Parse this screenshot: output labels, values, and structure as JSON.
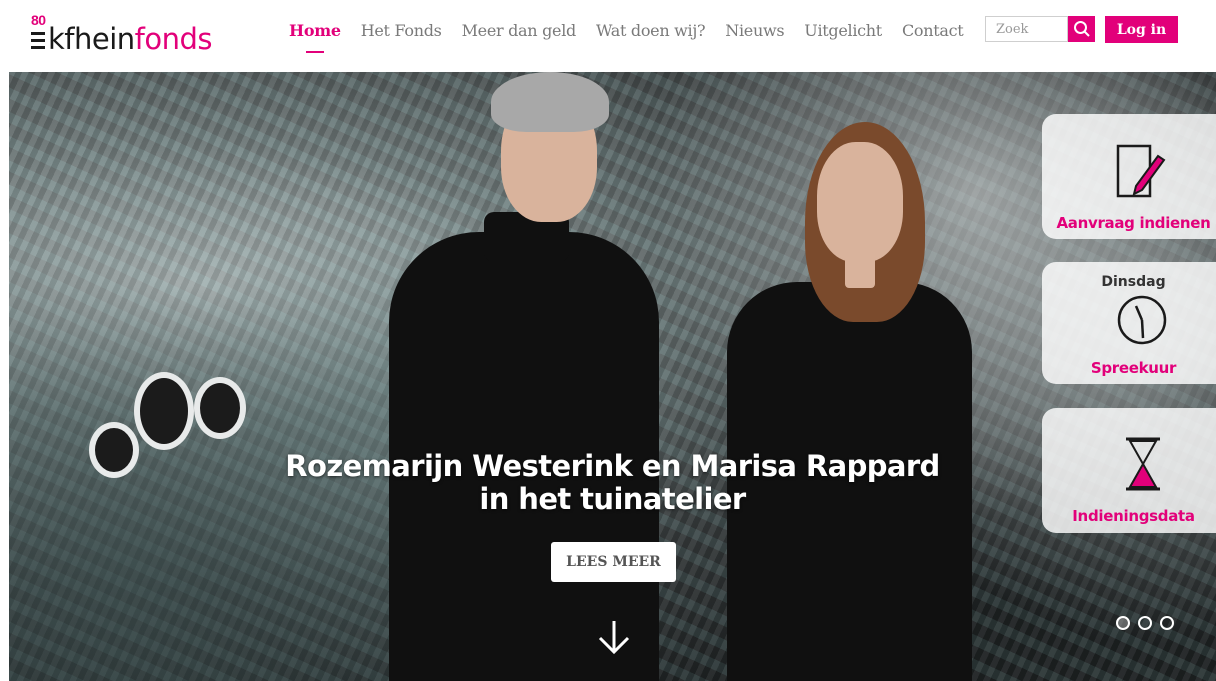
{
  "logo": {
    "badge": "80",
    "text_dark": "kfhein",
    "text_pink": "fonds"
  },
  "nav": {
    "items": [
      {
        "label": "Home",
        "active": true
      },
      {
        "label": "Het Fonds",
        "active": false
      },
      {
        "label": "Meer dan geld",
        "active": false
      },
      {
        "label": "Wat doen wij?",
        "active": false
      },
      {
        "label": "Nieuws",
        "active": false
      },
      {
        "label": "Uitgelicht",
        "active": false
      },
      {
        "label": "Contact",
        "active": false
      }
    ]
  },
  "search": {
    "placeholder": "Zoek"
  },
  "login": {
    "label": "Log in"
  },
  "hero": {
    "title_line1": "Rozemarijn Westerink en Marisa Rappard",
    "title_line2": "in het tuinatelier",
    "cta_label": "LEES MEER"
  },
  "side": {
    "apply_label": "Aanvraag indienen",
    "consult_day": "Dinsdag",
    "consult_label": "Spreekuur",
    "deadlines_label": "Indieningsdata"
  },
  "carousel": {
    "active_index": 0,
    "count": 3
  },
  "colors": {
    "accent": "#e2007a",
    "text_dark": "#1a1a1a",
    "nav_grey": "#7a7a7a"
  }
}
